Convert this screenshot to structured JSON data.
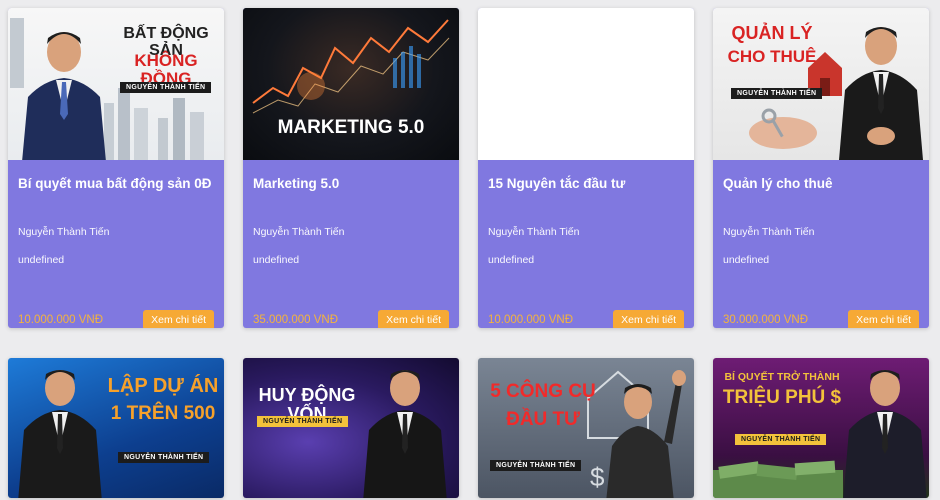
{
  "courses": [
    {
      "title": "Bí quyết mua bất động sản 0Đ",
      "teacher": "Nguyễn Thành Tiến",
      "extra": "undefined",
      "price": "10.000.000 VNĐ",
      "button": "Xem chi tiết",
      "thumb_line1": "BẤT ĐỘNG SẢN",
      "thumb_line2": "KHÔNG ĐỒNG",
      "thumb_tag": "NGUYỄN THÀNH TIẾN"
    },
    {
      "title": "Marketing 5.0",
      "teacher": "Nguyễn Thành Tiến",
      "extra": "undefined",
      "price": "35.000.000 VNĐ",
      "button": "Xem chi tiết",
      "thumb_line1": "MARKETING 5.0"
    },
    {
      "title": "15 Nguyên tắc đầu tư",
      "teacher": "Nguyễn Thành Tiến",
      "extra": "undefined",
      "price": "10.000.000 VNĐ",
      "button": "Xem chi tiết"
    },
    {
      "title": "Quản lý cho thuê",
      "teacher": "Nguyễn Thành Tiến",
      "extra": "undefined",
      "price": "30.000.000 VNĐ",
      "button": "Xem chi tiết",
      "thumb_line1": "QUẢN LÝ",
      "thumb_line2": "CHO THUÊ",
      "thumb_tag": "NGUYỄN THÀNH TIẾN"
    }
  ],
  "row2_thumbs": [
    {
      "line1": "LẬP DỰ ÁN",
      "line2": "1 TRÊN 500",
      "tag": "NGUYỄN THÀNH TIẾN"
    },
    {
      "line1": "HUY ĐỘNG VỐN",
      "tag": "NGUYỄN THÀNH TIẾN"
    },
    {
      "line1": "5 CÔNG CỤ",
      "line2": "ĐẦU TƯ",
      "tag": "NGUYỄN THÀNH TIẾN"
    },
    {
      "line1": "BÍ QUYẾT TRỞ THÀNH",
      "line2": "TRIỆU PHÚ $",
      "tag": "NGUYỄN THÀNH TIẾN"
    }
  ],
  "colors": {
    "card_body": "#8078e0",
    "price": "#f4b43c",
    "button": "#f6a935"
  }
}
